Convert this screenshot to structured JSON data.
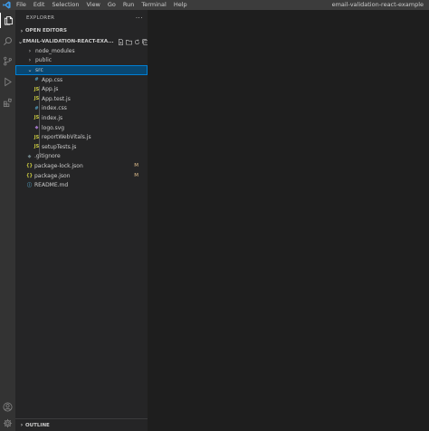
{
  "titlebar": {
    "menu": [
      "File",
      "Edit",
      "Selection",
      "View",
      "Go",
      "Run",
      "Terminal",
      "Help"
    ],
    "window_title": "email-validation-react-example"
  },
  "activity_bar": [
    "files-icon",
    "search-icon",
    "source-control-icon",
    "run-debug-icon",
    "extensions-icon",
    "account-icon",
    "settings-gear-icon"
  ],
  "explorer": {
    "header": "EXPLORER",
    "more_actions": "···",
    "open_editors": "OPEN EDITORS",
    "project": "EMAIL-VALIDATION-REACT-EXA...",
    "folders": [
      {
        "name": "node_modules",
        "chevron": "›"
      },
      {
        "name": "public",
        "chevron": "›"
      },
      {
        "name": "src",
        "chevron": "⌄"
      }
    ],
    "src_files": [
      {
        "name": "App.css",
        "icon": "#",
        "color": "#519aba"
      },
      {
        "name": "App.js",
        "icon": "JS",
        "color": "#cbcb41"
      },
      {
        "name": "App.test.js",
        "icon": "JS",
        "color": "#cbcb41"
      },
      {
        "name": "index.css",
        "icon": "#",
        "color": "#519aba"
      },
      {
        "name": "index.js",
        "icon": "JS",
        "color": "#cbcb41"
      },
      {
        "name": "logo.svg",
        "icon": "◆",
        "color": "#a074c4"
      },
      {
        "name": "reportWebVitals.js",
        "icon": "JS",
        "color": "#cbcb41"
      },
      {
        "name": "setupTests.js",
        "icon": "JS",
        "color": "#cbcb41"
      }
    ],
    "root_files": [
      {
        "name": ".gitignore",
        "icon": "◆",
        "color": "#41535b",
        "badge": ""
      },
      {
        "name": "package-lock.json",
        "icon": "{}",
        "color": "#cbcb41",
        "badge": "M"
      },
      {
        "name": "package.json",
        "icon": "{}",
        "color": "#cbcb41",
        "badge": "M"
      },
      {
        "name": "README.md",
        "icon": "ⓘ",
        "color": "#519aba",
        "badge": ""
      }
    ],
    "outline": "OUTLINE"
  },
  "colors": {
    "selection_bg": "#094771",
    "selection_border": "#007fd4",
    "modified_badge": "#e2c08d"
  }
}
